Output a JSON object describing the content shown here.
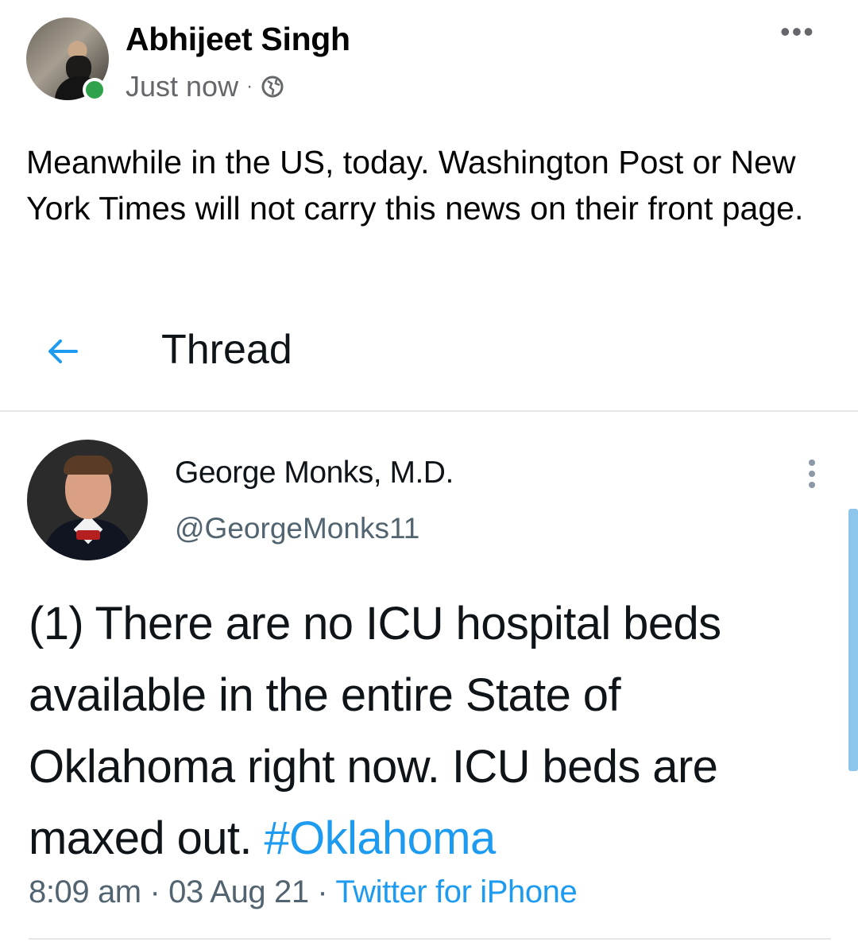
{
  "facebook_post": {
    "author": "Abhijeet Singh",
    "timestamp": "Just now",
    "separator": "·",
    "privacy_icon": "globe-icon",
    "more_icon": "•••",
    "text": "Meanwhile in the US, today.  Washington Post or New York Times will not carry this news on their front page."
  },
  "thread_header": {
    "back_icon": "back-arrow-icon",
    "title": "Thread"
  },
  "tweet": {
    "display_name": "George Monks, M.D.",
    "handle": "@GeorgeMonks11",
    "text": "(1) There are no ICU hospital beds available in the entire State of Oklahoma right now. ICU beds are maxed out. ",
    "hashtag": "#Oklahoma",
    "time": "8:09 am",
    "date": "03 Aug 21",
    "meta_separator": "·",
    "source": "Twitter for iPhone"
  },
  "colors": {
    "twitter_blue": "#1d9bf0",
    "online_green": "#31a24c",
    "secondary_text": "#65676b"
  }
}
